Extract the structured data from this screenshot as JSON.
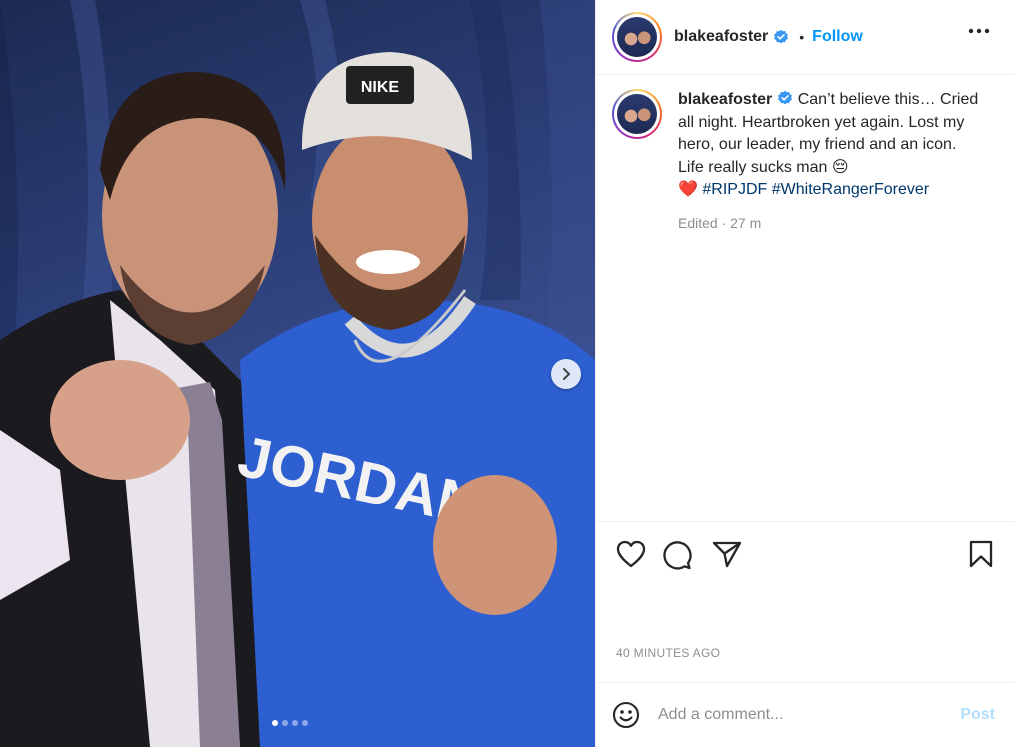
{
  "post": {
    "username": "blakeafoster",
    "follow_label": "Follow",
    "separator": "•",
    "caption_main": "Can’t believe this… Cried all night. Heartbroken yet again. Lost my hero, our leader, my friend and an icon. Life really sucks man 😔",
    "caption_heart": "❤️",
    "hashtags": [
      "#RIPJDF",
      "#WhiteRangerForever"
    ],
    "edited": "Edited · 27 m",
    "timestamp": "40 MINUTES AGO",
    "comment_placeholder": "Add a comment...",
    "post_label": "Post"
  },
  "media": {
    "slide_count": 4,
    "active_slide": 1,
    "cap_text": "NIKE",
    "shirt_text": "JORDAN"
  },
  "icons": {
    "verified": "verified-badge-icon",
    "more": "more-options-icon",
    "like": "heart-icon",
    "comment": "comment-icon",
    "share": "share-icon",
    "save": "bookmark-icon",
    "emoji": "emoji-icon",
    "next": "chevron-right-icon"
  },
  "colors": {
    "accent": "#0095f6",
    "hashtag": "#00376b",
    "muted": "#8e8e8e",
    "post_disabled": "#b2dffc"
  }
}
